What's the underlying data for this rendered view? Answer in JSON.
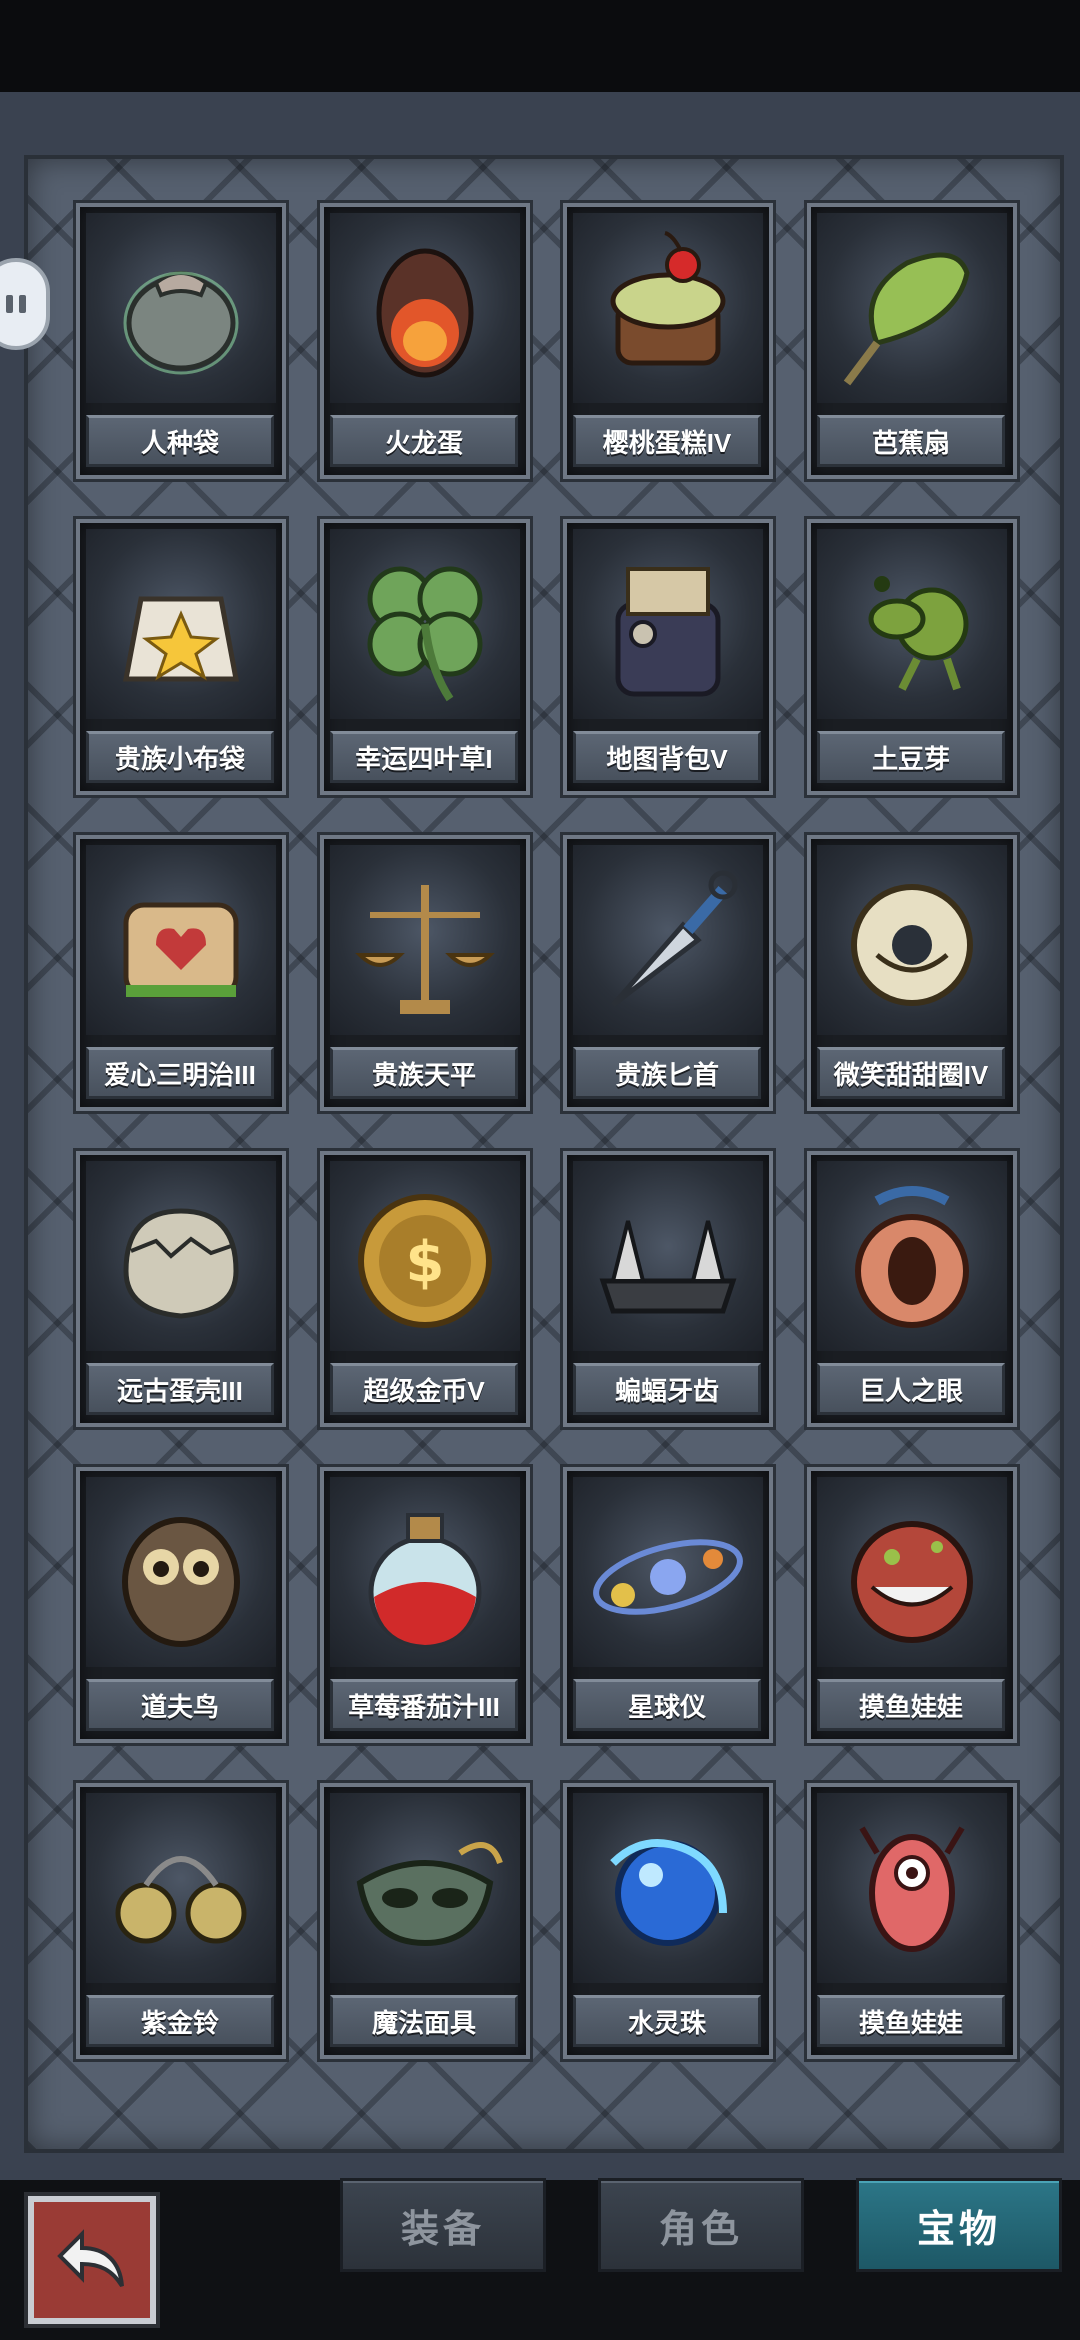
{
  "items": [
    {
      "label": "人种袋",
      "icon": "seed-bag-icon"
    },
    {
      "label": "火龙蛋",
      "icon": "fire-dragon-egg-icon"
    },
    {
      "label": "樱桃蛋糕IV",
      "icon": "cherry-cake-icon"
    },
    {
      "label": "芭蕉扇",
      "icon": "banana-leaf-fan-icon"
    },
    {
      "label": "贵族小布袋",
      "icon": "noble-cloth-bag-icon"
    },
    {
      "label": "幸运四叶草I",
      "icon": "four-leaf-clover-icon"
    },
    {
      "label": "地图背包V",
      "icon": "map-backpack-icon"
    },
    {
      "label": "土豆芽",
      "icon": "potato-sprout-icon"
    },
    {
      "label": "爱心三明治III",
      "icon": "heart-sandwich-icon"
    },
    {
      "label": "贵族天平",
      "icon": "noble-scales-icon"
    },
    {
      "label": "贵族匕首",
      "icon": "noble-dagger-icon"
    },
    {
      "label": "微笑甜甜圈IV",
      "icon": "smile-donut-icon"
    },
    {
      "label": "远古蛋壳III",
      "icon": "ancient-eggshell-icon"
    },
    {
      "label": "超级金币V",
      "icon": "super-gold-coin-icon"
    },
    {
      "label": "蝙蝠牙齿",
      "icon": "bat-teeth-icon"
    },
    {
      "label": "巨人之眼",
      "icon": "giant-eye-icon"
    },
    {
      "label": "道夫鸟",
      "icon": "owl-bird-icon"
    },
    {
      "label": "草莓番茄汁III",
      "icon": "strawberry-tomato-juice-icon"
    },
    {
      "label": "星球仪",
      "icon": "orrery-icon"
    },
    {
      "label": "摸鱼娃娃",
      "icon": "slacker-doll-icon"
    },
    {
      "label": "紫金铃",
      "icon": "purple-gold-bell-icon"
    },
    {
      "label": "魔法面具",
      "icon": "magic-mask-icon"
    },
    {
      "label": "水灵珠",
      "icon": "water-spirit-orb-icon"
    },
    {
      "label": "摸鱼娃娃",
      "icon": "pink-doll-icon"
    }
  ],
  "tabs": [
    {
      "label": "装备",
      "active": false
    },
    {
      "label": "角色",
      "active": false
    },
    {
      "label": "宝物",
      "active": true
    }
  ],
  "back_button": {
    "icon": "back-arrow-icon"
  },
  "side_handle": {
    "icon": "pause-icon"
  }
}
